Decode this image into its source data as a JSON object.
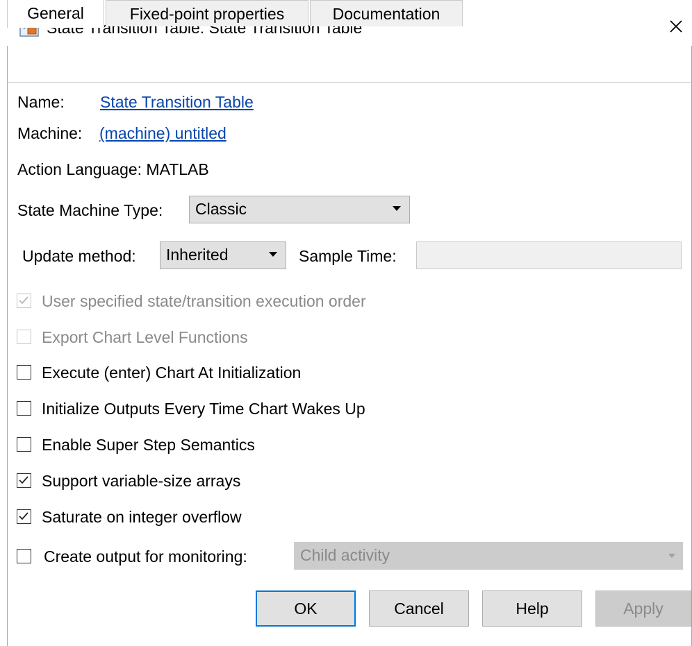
{
  "window": {
    "title": "State Transition Table: State Transition Table"
  },
  "tabs": [
    {
      "label": "General",
      "active": true
    },
    {
      "label": "Fixed-point properties",
      "active": false
    },
    {
      "label": "Documentation",
      "active": false
    }
  ],
  "general": {
    "name_label": "Name:",
    "name_value": "State Transition Table",
    "machine_label": "Machine:",
    "machine_value": "(machine) untitled",
    "action_language": "Action Language: MATLAB",
    "state_machine_type_label": "State Machine Type:",
    "state_machine_type_value": "Classic",
    "update_method_label": "Update method:",
    "update_method_value": "Inherited",
    "sample_time_label": "Sample Time:",
    "sample_time_value": ""
  },
  "checkboxes": [
    {
      "label": "User specified state/transition execution order",
      "checked": true,
      "enabled": false
    },
    {
      "label": "Export Chart Level Functions",
      "checked": false,
      "enabled": false
    },
    {
      "label": "Execute (enter) Chart At Initialization",
      "checked": false,
      "enabled": true
    },
    {
      "label": "Initialize Outputs Every Time Chart Wakes Up",
      "checked": false,
      "enabled": true
    },
    {
      "label": "Enable Super Step Semantics",
      "checked": false,
      "enabled": true
    },
    {
      "label": "Support variable-size arrays",
      "checked": true,
      "enabled": true
    },
    {
      "label": "Saturate on integer overflow",
      "checked": true,
      "enabled": true
    }
  ],
  "monitoring": {
    "label": "Create output for monitoring:",
    "checked": false,
    "select_value": "Child activity",
    "select_enabled": false
  },
  "buttons": {
    "ok": "OK",
    "cancel": "Cancel",
    "help": "Help",
    "apply": "Apply"
  },
  "colors": {
    "link": "#0645ad",
    "default_button_border": "#0078d7",
    "disabled_text": "#8a8a8a"
  }
}
